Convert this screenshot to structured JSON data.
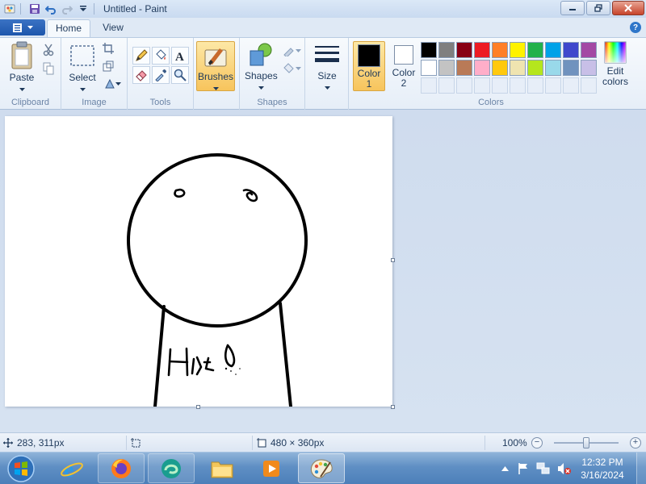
{
  "window": {
    "title": "Untitled - Paint"
  },
  "tabs": {
    "home": "Home",
    "view": "View",
    "help": "?"
  },
  "ribbon": {
    "clipboard": {
      "paste_label": "Paste",
      "group_label": "Clipboard"
    },
    "image": {
      "select_label": "Select",
      "group_label": "Image"
    },
    "tools": {
      "group_label": "Tools"
    },
    "brushes": {
      "label": "Brushes"
    },
    "shapes": {
      "label": "Shapes",
      "group_label": "Shapes"
    },
    "size": {
      "label": "Size"
    },
    "colors": {
      "color1_label": "Color",
      "color1_num": "1",
      "color2_label": "Color",
      "color2_num": "2",
      "edit_label": "Edit",
      "edit_label2": "colors",
      "group_label": "Colors",
      "color1_value": "#000000",
      "color2_value": "#ffffff",
      "palette": [
        "#000000",
        "#7f7f7f",
        "#880015",
        "#ed1c24",
        "#ff7f27",
        "#fff200",
        "#22b14c",
        "#00a2e8",
        "#3f48cc",
        "#a349a4",
        "#ffffff",
        "#c3c3c3",
        "#b97a57",
        "#ffaec9",
        "#ffc90e",
        "#efe4b0",
        "#b5e61d",
        "#99d9ea",
        "#7092be",
        "#c8bfe7"
      ]
    }
  },
  "status": {
    "cursor_pos": "283, 311px",
    "canvas_size": "480 × 360px",
    "zoom": "100%"
  },
  "taskbar": {
    "time": "12:32 PM",
    "date": "3/16/2024"
  }
}
